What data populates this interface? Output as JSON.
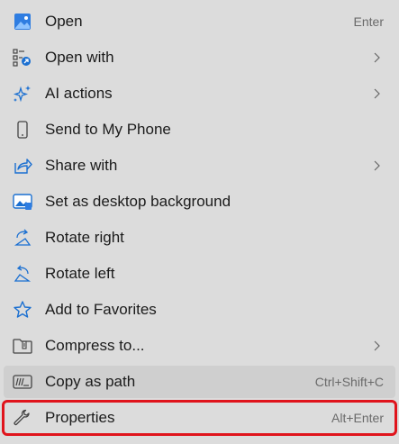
{
  "menu": {
    "items": [
      {
        "label": "Open",
        "shortcut": "Enter"
      },
      {
        "label": "Open with",
        "submenu": true
      },
      {
        "label": "AI actions",
        "submenu": true
      },
      {
        "label": "Send to My Phone"
      },
      {
        "label": "Share with",
        "submenu": true
      },
      {
        "label": "Set as desktop background"
      },
      {
        "label": "Rotate right"
      },
      {
        "label": "Rotate left"
      },
      {
        "label": "Add to Favorites"
      },
      {
        "label": "Compress to...",
        "submenu": true
      },
      {
        "label": "Copy as path",
        "shortcut": "Ctrl+Shift+C"
      },
      {
        "label": "Properties",
        "shortcut": "Alt+Enter"
      }
    ]
  },
  "colors": {
    "highlight_border": "#e0141c",
    "accent": "#1a6fd1"
  }
}
